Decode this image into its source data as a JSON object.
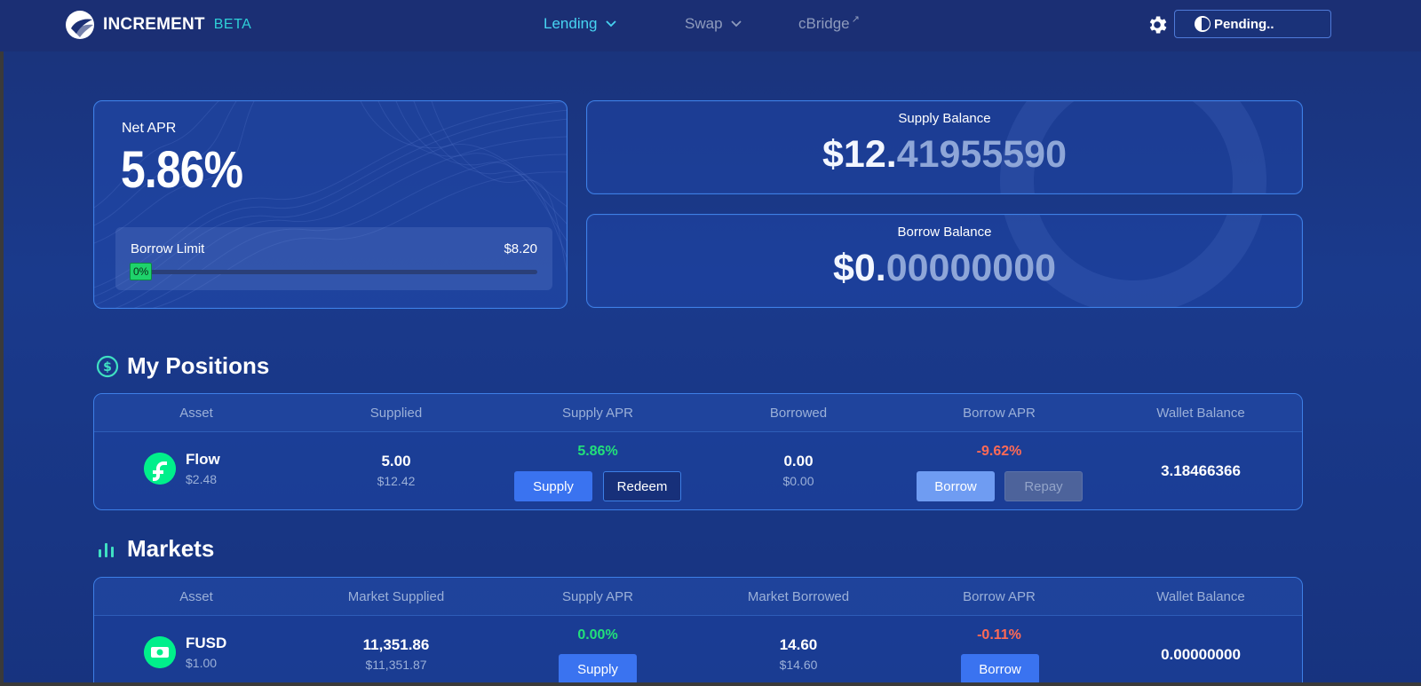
{
  "nav": {
    "brand": "INCREMENT",
    "beta": "BETA",
    "lending": "Lending",
    "swap": "Swap",
    "cbridge": "cBridge",
    "wallet_status": "Pending.."
  },
  "summary": {
    "net_apr_label": "Net APR",
    "net_apr_value": "5.86%",
    "borrow_limit_label": "Borrow Limit",
    "borrow_limit_value": "$8.20",
    "borrow_limit_pct": "0%",
    "borrow_limit_fraction": 0,
    "supply_balance_label": "Supply Balance",
    "supply_balance_int": "$12.",
    "supply_balance_dec": "41955590",
    "borrow_balance_label": "Borrow Balance",
    "borrow_balance_int": "$0.",
    "borrow_balance_dec": "00000000"
  },
  "positions": {
    "title": "My Positions",
    "headers": [
      "Asset",
      "Supplied",
      "Supply APR",
      "Borrowed",
      "Borrow APR",
      "Wallet Balance"
    ],
    "rows": [
      {
        "asset": "Flow",
        "price": "$2.48",
        "supplied": "5.00",
        "supplied_usd": "$12.42",
        "supply_apr": "5.86%",
        "borrowed": "0.00",
        "borrowed_usd": "$0.00",
        "borrow_apr": "-9.62%",
        "wallet_balance": "3.18466366",
        "supply_label": "Supply",
        "redeem_label": "Redeem",
        "borrow_label": "Borrow",
        "repay_label": "Repay"
      }
    ]
  },
  "markets": {
    "title": "Markets",
    "headers": [
      "Asset",
      "Market Supplied",
      "Supply APR",
      "Market Borrowed",
      "Borrow APR",
      "Wallet Balance"
    ],
    "rows": [
      {
        "asset": "FUSD",
        "price": "$1.00",
        "supplied": "11,351.86",
        "supplied_usd": "$11,351.87",
        "supply_apr": "0.00%",
        "borrowed": "14.60",
        "borrowed_usd": "$14.60",
        "borrow_apr": "-0.11%",
        "wallet_balance": "0.00000000",
        "supply_label": "Supply",
        "borrow_label": "Borrow"
      }
    ]
  },
  "colors": {
    "accent_cyan": "#47d4f2",
    "positive": "#22e07a",
    "negative": "#ff6a55",
    "primary_button": "#3a73f0",
    "card_border": "#3d7fe6"
  }
}
